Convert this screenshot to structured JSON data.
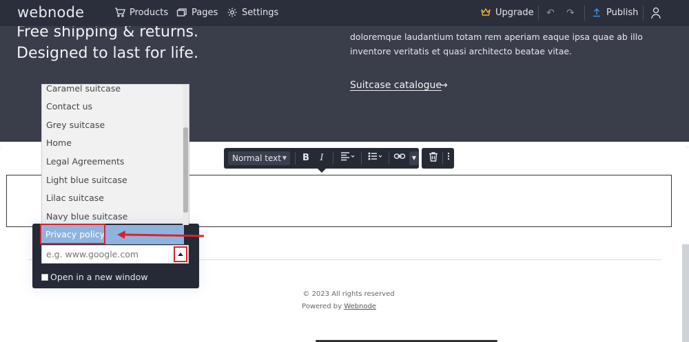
{
  "topbar": {
    "logo": "webnode",
    "nav": {
      "products": "Products",
      "pages": "Pages",
      "settings": "Settings",
      "upgrade": "Upgrade",
      "publish": "Publish"
    },
    "undo_glyph": "↶",
    "redo_glyph": "↷"
  },
  "hero": {
    "line1": "Free shipping & returns.",
    "line2": "Designed to last for life.",
    "paragraph": "doloremque laudantium totam rem aperiam eaque ipsa quae ab illo inventore veritatis et quasi architecto beatae vitae.",
    "link_label": "Suitcase catalogue",
    "link_arrow": "→"
  },
  "toolbar": {
    "text_style": "Normal text",
    "bold": "B",
    "italic": "I"
  },
  "dropdown": {
    "items": [
      "Caramel suitcase",
      "Contact us",
      "Grey suitcase",
      "Home",
      "Legal Agreements",
      "Light blue suitcase",
      "Lilac suitcase",
      "Navy blue suitcase"
    ],
    "selected": "Privacy policy"
  },
  "link_panel": {
    "url_placeholder": "e.g. www.google.com",
    "new_window_label": "Open in a new window"
  },
  "footer": {
    "copyright": "© 2023 All rights reserved",
    "powered_prefix": "Powered by ",
    "powered_link": "Webnode"
  },
  "colors": {
    "topbar": "#2b2f3b",
    "hero": "#3a3d4a",
    "selected": "#8fb3de",
    "annotation": "#d8242b",
    "upgrade_crown": "#f0b429",
    "publish_icon": "#3b8ee8"
  }
}
